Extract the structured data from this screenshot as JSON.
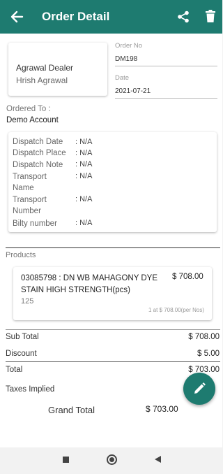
{
  "appbar": {
    "title": "Order Detail",
    "back_icon": "arrow-left-icon",
    "share_icon": "share-icon",
    "delete_icon": "trash-icon",
    "color": "#1e7b70"
  },
  "dealer": {
    "name": "Agrawal Dealer",
    "person": "Hrish Agrawal"
  },
  "order": {
    "no_label": "Order No",
    "no_value": "DM198",
    "date_label": "Date",
    "date_value": "2021-07-21"
  },
  "ordered_to": {
    "label": "Ordered To :",
    "value": "Demo Account"
  },
  "dispatch": {
    "date_label": "Dispatch Date",
    "date_value": ": N/A",
    "place_label": "Dispatch Place",
    "place_value": ": N/A",
    "note_label": "Dispatch Note",
    "note_value": ": N/A",
    "transport_name_label_1": "Transport",
    "transport_name_label_2": "Name",
    "transport_name_value": ": N/A",
    "transport_number_label_1": "Transport",
    "transport_number_label_2": "Number",
    "transport_number_value": ": N/A",
    "bilty_label": "Bilty number",
    "bilty_value": ": N/A"
  },
  "products": {
    "label": "Products",
    "items": [
      {
        "name": "03085798 : DN WB MAHAGONY DYE STAIN HIGH STRENGTH(pcs)",
        "price": "$ 708.00",
        "qty": "125",
        "rate": "1 at $ 708.00(per Nos)"
      }
    ]
  },
  "summary": {
    "subtotal_label": "Sub Total",
    "subtotal_value": "$ 708.00",
    "discount_label": "Discount",
    "discount_value": "$ 5.00",
    "total_label": "Total",
    "total_value": "$ 703.00",
    "taxes_label": "Taxes Implied",
    "grand_total_label": "Grand Total",
    "grand_total_value": "$ 703.00"
  },
  "fab": {
    "icon": "pencil-icon"
  },
  "navbar": {
    "recents_icon": "square-icon",
    "home_icon": "circle-icon",
    "back_icon": "triangle-back-icon"
  }
}
